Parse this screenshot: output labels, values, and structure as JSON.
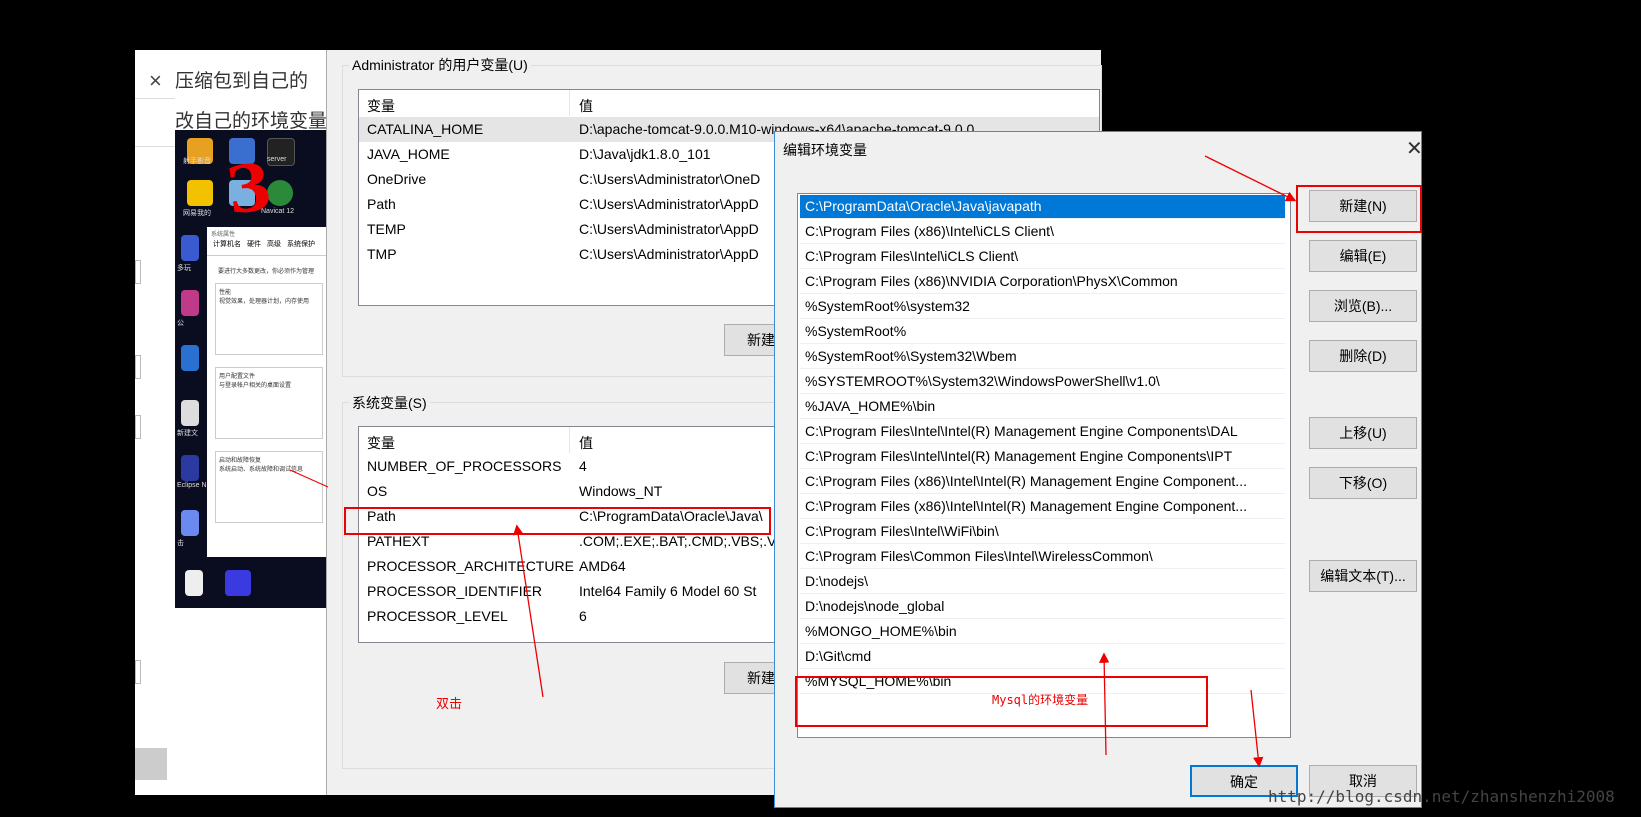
{
  "background_window": {
    "close_glyph": "×",
    "header1": "压缩包到自己的",
    "header2": "改自己的环境变量"
  },
  "thumbnail": {
    "icon_caps": [
      "射手影音",
      "server",
      "网易我的",
      "Navicat 12",
      "多玩",
      "公",
      "新建文",
      "Eclipse Neo",
      "击"
    ],
    "sys_tabs": [
      "计算机名",
      "硬件",
      "高级",
      "系统保护"
    ],
    "sys_title": "系统属性",
    "box1_title": "性能",
    "box1_text": "要进行大多数更改，你必须作为管理",
    "box1_text2": "视觉效果，处理器计划，内存使用",
    "box2_title": "用户配置文件",
    "box2_text": "与登录帐户相关的桌面设置",
    "box3_title": "启动和故障恢复",
    "box3_text": "系统启动、系统故障和调试信息",
    "annotation_mark": "3"
  },
  "env_dialog": {
    "user_group_label": "Administrator 的用户变量(U)",
    "system_group_label": "系统变量(S)",
    "col_var": "变量",
    "col_val": "值",
    "user_vars": [
      {
        "name": "CATALINA_HOME",
        "value": "D:\\apache-tomcat-9.0.0.M10-windows-x64\\apache-tomcat-9.0.0"
      },
      {
        "name": "JAVA_HOME",
        "value": "D:\\Java\\jdk1.8.0_101"
      },
      {
        "name": "OneDrive",
        "value": "C:\\Users\\Administrator\\OneD"
      },
      {
        "name": "Path",
        "value": "C:\\Users\\Administrator\\AppD"
      },
      {
        "name": "TEMP",
        "value": "C:\\Users\\Administrator\\AppD"
      },
      {
        "name": "TMP",
        "value": "C:\\Users\\Administrator\\AppD"
      }
    ],
    "system_vars": [
      {
        "name": "NUMBER_OF_PROCESSORS",
        "value": "4"
      },
      {
        "name": "OS",
        "value": "Windows_NT"
      },
      {
        "name": "Path",
        "value": "C:\\ProgramData\\Oracle\\Java\\"
      },
      {
        "name": "PATHEXT",
        "value": ".COM;.EXE;.BAT;.CMD;.VBS;.V"
      },
      {
        "name": "PROCESSOR_ARCHITECTURE",
        "value": "AMD64"
      },
      {
        "name": "PROCESSOR_IDENTIFIER",
        "value": "Intel64 Family 6 Model 60 St"
      },
      {
        "name": "PROCESSOR_LEVEL",
        "value": "6"
      }
    ],
    "new_button_user": "新建",
    "new_button_system": "新建"
  },
  "edit_dialog": {
    "title": "编辑环境变量",
    "close_glyph": "✕",
    "paths": [
      "C:\\ProgramData\\Oracle\\Java\\javapath",
      "C:\\Program Files (x86)\\Intel\\iCLS Client\\",
      "C:\\Program Files\\Intel\\iCLS Client\\",
      "C:\\Program Files (x86)\\NVIDIA Corporation\\PhysX\\Common",
      "%SystemRoot%\\system32",
      "%SystemRoot%",
      "%SystemRoot%\\System32\\Wbem",
      "%SYSTEMROOT%\\System32\\WindowsPowerShell\\v1.0\\",
      "%JAVA_HOME%\\bin",
      "C:\\Program Files\\Intel\\Intel(R) Management Engine Components\\DAL",
      "C:\\Program Files\\Intel\\Intel(R) Management Engine Components\\IPT",
      "C:\\Program Files (x86)\\Intel\\Intel(R) Management Engine Component...",
      "C:\\Program Files (x86)\\Intel\\Intel(R) Management Engine Component...",
      "C:\\Program Files\\Intel\\WiFi\\bin\\",
      "C:\\Program Files\\Common Files\\Intel\\WirelessCommon\\",
      "D:\\nodejs\\",
      "D:\\nodejs\\node_global",
      "%MONGO_HOME%\\bin",
      "D:\\Git\\cmd",
      "%MYSQL_HOME%\\bin"
    ],
    "buttons": {
      "new": "新建(N)",
      "edit": "编辑(E)",
      "browse": "浏览(B)...",
      "delete": "删除(D)",
      "move_up": "上移(U)",
      "move_down": "下移(O)",
      "edit_text": "编辑文本(T)...",
      "ok": "确定",
      "cancel": "取消"
    }
  },
  "annotations": {
    "double_click": "双击",
    "mysql_label": "Mysql的环境变量",
    "color": "#e00000"
  },
  "watermark": "http://blog.csdn.net/zhanshenzhi2008"
}
